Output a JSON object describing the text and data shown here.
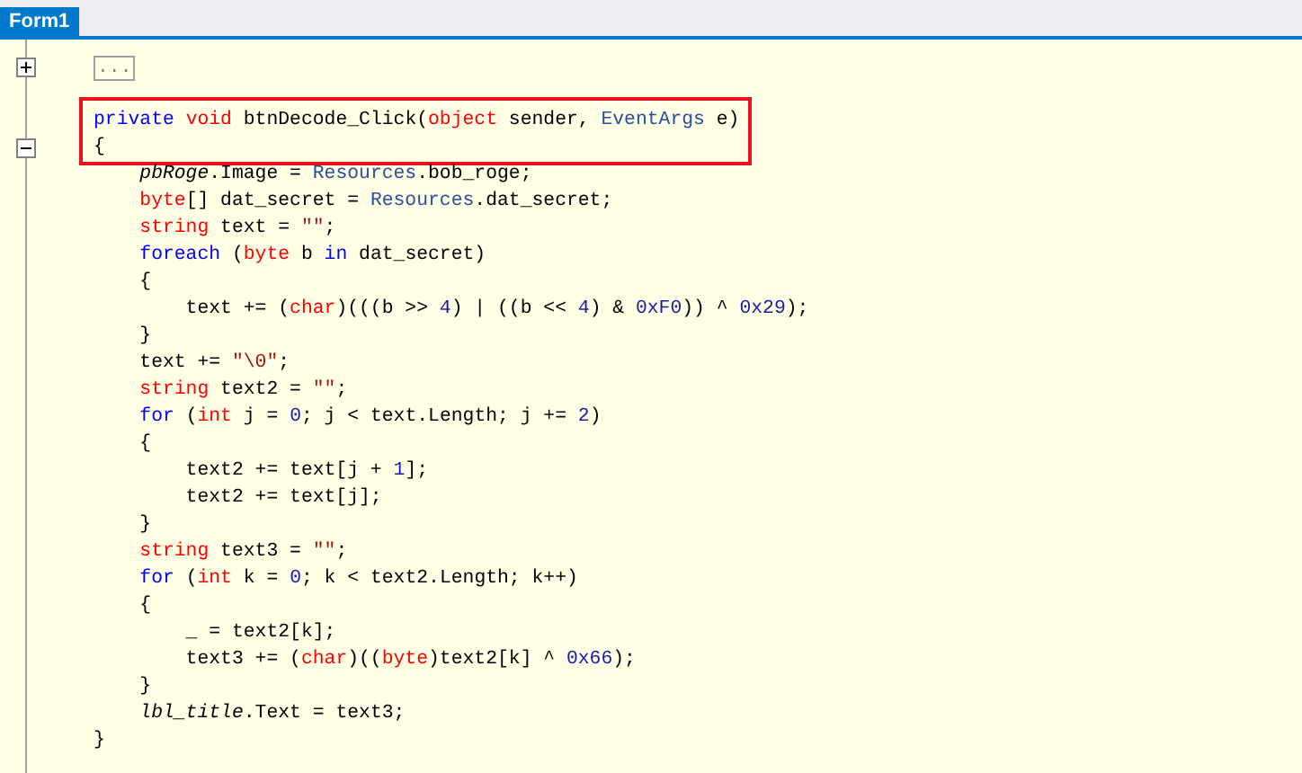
{
  "tab": {
    "label": "Form1",
    "selected": true
  },
  "lines": [
    {
      "fold": {
        "expanded": false
      },
      "collapsed": "...",
      "highlighted": false
    },
    {
      "highlighted": false
    },
    {
      "highlighted": true,
      "tokens": [
        {
          "kind": "keyword",
          "text": "private"
        },
        {
          "kind": "type",
          "text": " void"
        },
        {
          "kind": "plain",
          "text": " btnDecode_Click("
        },
        {
          "kind": "type",
          "text": "object"
        },
        {
          "kind": "plain",
          "text": " sender, "
        },
        {
          "kind": "class",
          "text": "EventArgs"
        },
        {
          "kind": "plain",
          "text": " e)"
        }
      ]
    },
    {
      "fold": {
        "expanded": true
      },
      "highlighted": true,
      "tokens": [
        {
          "kind": "plain",
          "text": "{"
        }
      ]
    },
    {
      "highlighted": false,
      "tokens": [
        {
          "kind": "field",
          "text": "    pbRoge"
        },
        {
          "kind": "plain",
          "text": ".Image = "
        },
        {
          "kind": "class",
          "text": "Resources"
        },
        {
          "kind": "plain",
          "text": ".bob_roge;"
        }
      ]
    },
    {
      "highlighted": false,
      "tokens": [
        {
          "kind": "type",
          "text": "    byte"
        },
        {
          "kind": "plain",
          "text": "[] dat_secret = "
        },
        {
          "kind": "class",
          "text": "Resources"
        },
        {
          "kind": "plain",
          "text": ".dat_secret;"
        }
      ]
    },
    {
      "highlighted": false,
      "tokens": [
        {
          "kind": "type",
          "text": "    string"
        },
        {
          "kind": "plain",
          "text": " text = "
        },
        {
          "kind": "string",
          "text": "\"\""
        },
        {
          "kind": "plain",
          "text": ";"
        }
      ]
    },
    {
      "highlighted": false,
      "tokens": [
        {
          "kind": "keyword",
          "text": "    foreach"
        },
        {
          "kind": "plain",
          "text": " ("
        },
        {
          "kind": "type",
          "text": "byte"
        },
        {
          "kind": "plain",
          "text": " b "
        },
        {
          "kind": "keyword",
          "text": "in"
        },
        {
          "kind": "plain",
          "text": " dat_secret)"
        }
      ]
    },
    {
      "highlighted": false,
      "tokens": [
        {
          "kind": "plain",
          "text": "    {"
        }
      ]
    },
    {
      "highlighted": false,
      "tokens": [
        {
          "kind": "plain",
          "text": "        text += ("
        },
        {
          "kind": "type",
          "text": "char"
        },
        {
          "kind": "plain",
          "text": ")(((b >> "
        },
        {
          "kind": "number",
          "text": "4"
        },
        {
          "kind": "plain",
          "text": ") | ((b << "
        },
        {
          "kind": "number",
          "text": "4"
        },
        {
          "kind": "plain",
          "text": ") & "
        },
        {
          "kind": "number",
          "text": "0xF0"
        },
        {
          "kind": "plain",
          "text": ")) ^ "
        },
        {
          "kind": "number",
          "text": "0x29"
        },
        {
          "kind": "plain",
          "text": ");"
        }
      ]
    },
    {
      "highlighted": false,
      "tokens": [
        {
          "kind": "plain",
          "text": "    }"
        }
      ]
    },
    {
      "highlighted": false,
      "tokens": [
        {
          "kind": "plain",
          "text": "    text += "
        },
        {
          "kind": "string",
          "text": "\"\\0\""
        },
        {
          "kind": "plain",
          "text": ";"
        }
      ]
    },
    {
      "highlighted": false,
      "tokens": [
        {
          "kind": "type",
          "text": "    string"
        },
        {
          "kind": "plain",
          "text": " text2 = "
        },
        {
          "kind": "string",
          "text": "\"\""
        },
        {
          "kind": "plain",
          "text": ";"
        }
      ]
    },
    {
      "highlighted": false,
      "tokens": [
        {
          "kind": "keyword",
          "text": "    for"
        },
        {
          "kind": "plain",
          "text": " ("
        },
        {
          "kind": "type",
          "text": "int"
        },
        {
          "kind": "plain",
          "text": " j = "
        },
        {
          "kind": "number",
          "text": "0"
        },
        {
          "kind": "plain",
          "text": "; j < text.Length; j += "
        },
        {
          "kind": "number",
          "text": "2"
        },
        {
          "kind": "plain",
          "text": ")"
        }
      ]
    },
    {
      "highlighted": false,
      "tokens": [
        {
          "kind": "plain",
          "text": "    {"
        }
      ]
    },
    {
      "highlighted": false,
      "tokens": [
        {
          "kind": "plain",
          "text": "        text2 += text[j + "
        },
        {
          "kind": "number",
          "text": "1"
        },
        {
          "kind": "plain",
          "text": "];"
        }
      ]
    },
    {
      "highlighted": false,
      "tokens": [
        {
          "kind": "plain",
          "text": "        text2 += text[j];"
        }
      ]
    },
    {
      "highlighted": false,
      "tokens": [
        {
          "kind": "plain",
          "text": "    }"
        }
      ]
    },
    {
      "highlighted": false,
      "tokens": [
        {
          "kind": "type",
          "text": "    string"
        },
        {
          "kind": "plain",
          "text": " text3 = "
        },
        {
          "kind": "string",
          "text": "\"\""
        },
        {
          "kind": "plain",
          "text": ";"
        }
      ]
    },
    {
      "highlighted": false,
      "tokens": [
        {
          "kind": "keyword",
          "text": "    for"
        },
        {
          "kind": "plain",
          "text": " ("
        },
        {
          "kind": "type",
          "text": "int"
        },
        {
          "kind": "plain",
          "text": " k = "
        },
        {
          "kind": "number",
          "text": "0"
        },
        {
          "kind": "plain",
          "text": "; k < text2.Length; k++)"
        }
      ]
    },
    {
      "highlighted": false,
      "tokens": [
        {
          "kind": "plain",
          "text": "    {"
        }
      ]
    },
    {
      "highlighted": false,
      "tokens": [
        {
          "kind": "plain",
          "text": "        _ = text2[k];"
        }
      ]
    },
    {
      "highlighted": false,
      "tokens": [
        {
          "kind": "plain",
          "text": "        text3 += ("
        },
        {
          "kind": "type",
          "text": "char"
        },
        {
          "kind": "plain",
          "text": ")(("
        },
        {
          "kind": "type",
          "text": "byte"
        },
        {
          "kind": "plain",
          "text": ")text2[k] ^ "
        },
        {
          "kind": "number",
          "text": "0x66"
        },
        {
          "kind": "plain",
          "text": ");"
        }
      ]
    },
    {
      "highlighted": false,
      "tokens": [
        {
          "kind": "plain",
          "text": "    }"
        }
      ]
    },
    {
      "highlighted": false,
      "tokens": [
        {
          "kind": "field",
          "text": "    lbl_title"
        },
        {
          "kind": "plain",
          "text": ".Text = text3;"
        }
      ]
    },
    {
      "highlighted": false,
      "tokens": [
        {
          "kind": "plain",
          "text": "}"
        }
      ]
    }
  ]
}
